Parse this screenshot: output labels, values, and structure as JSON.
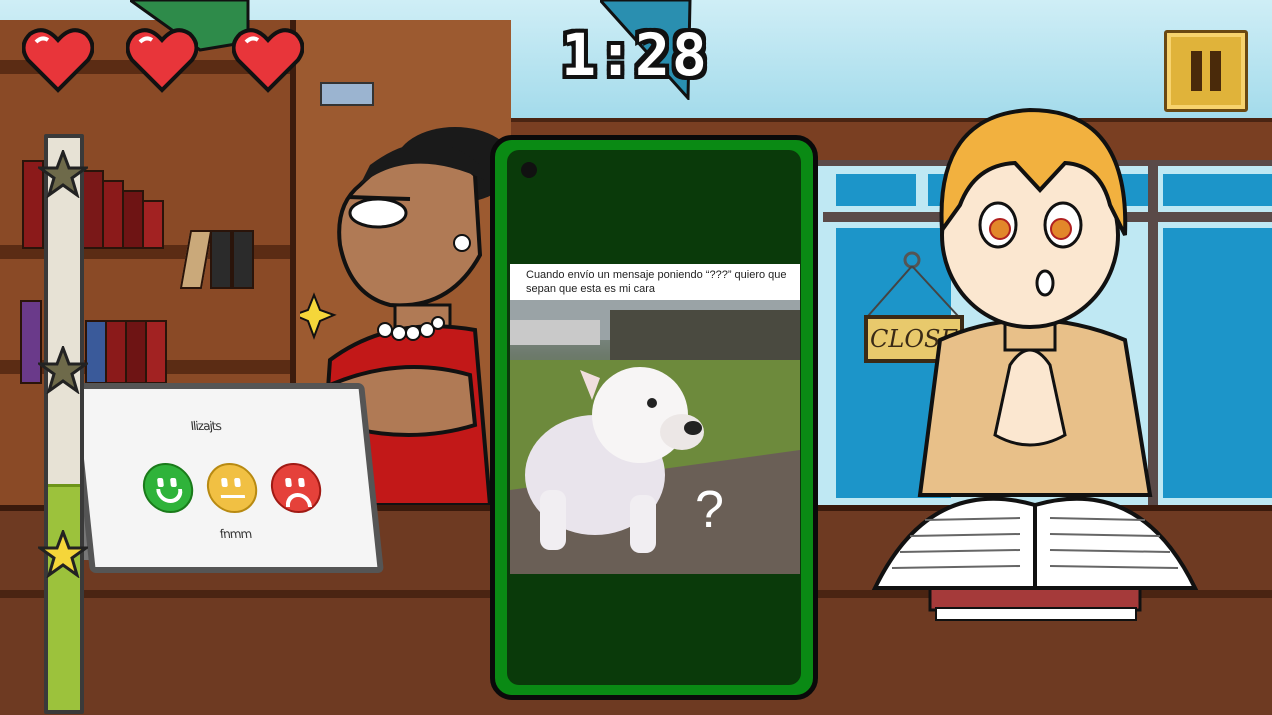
{
  "hud": {
    "timer": "1:28",
    "lives": 3,
    "approval_meter_fraction": 0.39
  },
  "tablet": {
    "title_scribble": "Ilizajts",
    "footer_scribble": "fnmm",
    "faces": [
      "happy",
      "neutral",
      "angry"
    ]
  },
  "scene": {
    "sign_text": "CLOSE"
  },
  "phone": {
    "caption": "Cuando envío un mensaje poniendo “???” quiero que sepan que esta es mi cara",
    "overlay_text": "?"
  },
  "icons": {
    "heart": "heart-icon",
    "star": "star-icon",
    "pause": "pause-icon"
  },
  "colors": {
    "heart": "#e8353a",
    "phone_frame": "#0a8a14",
    "meter_fill": "#9cc23c",
    "pause_button": "#e0b33a"
  }
}
